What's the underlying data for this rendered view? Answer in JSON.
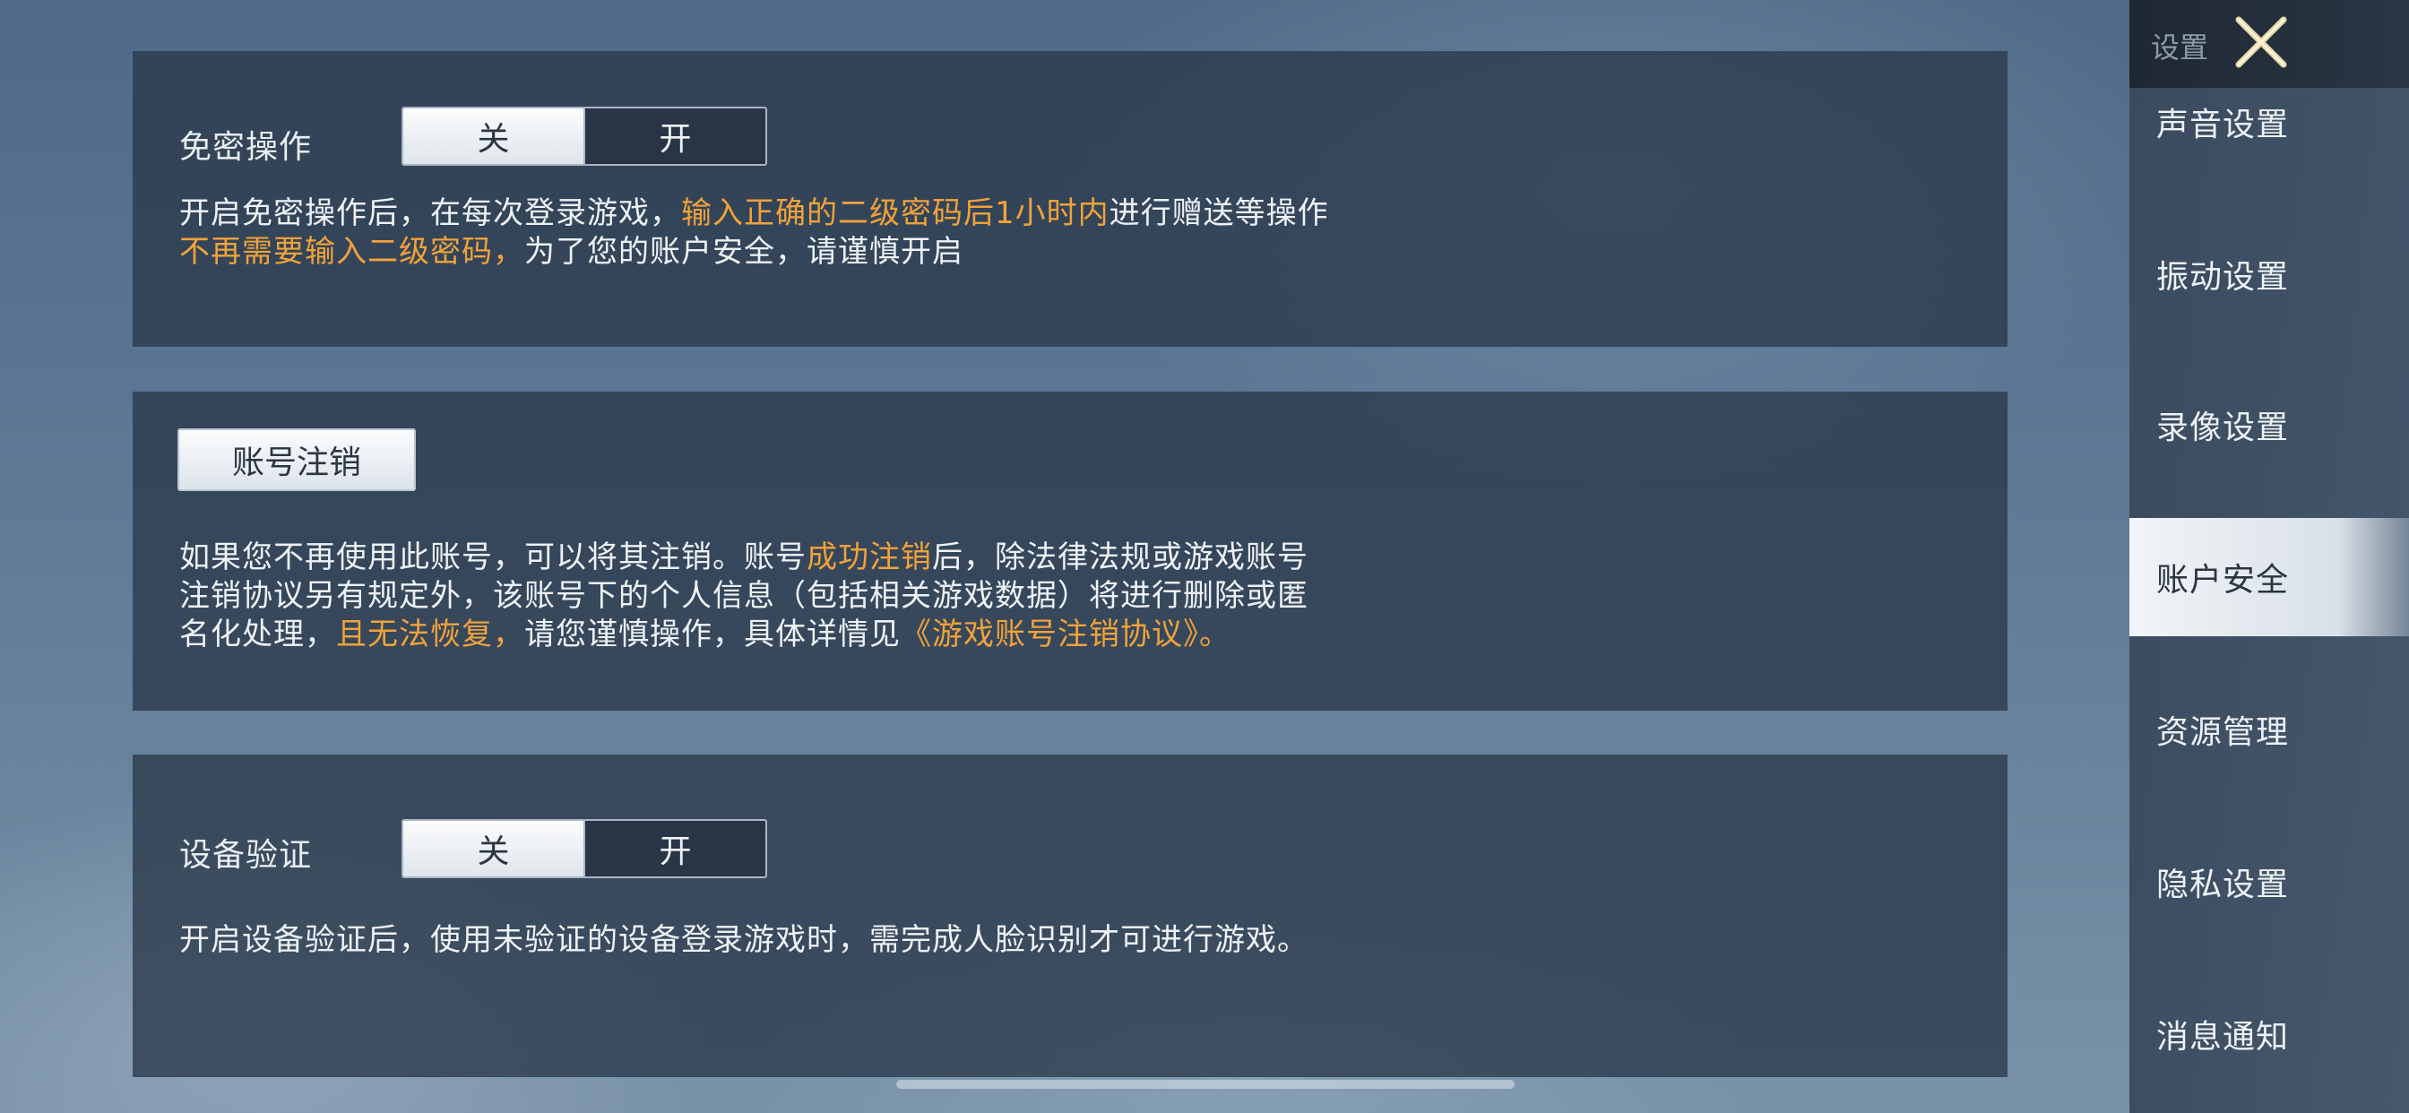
{
  "panels": {
    "password_free": {
      "label": "免密操作",
      "toggle": {
        "off_label": "关",
        "on_label": "开",
        "selected": "关"
      },
      "desc": {
        "line1_a": "开启免密操作后，在每次登录游戏，",
        "line1_hl": "输入正确的二级密码后1小时内",
        "line1_b": "进行赠送等操作",
        "line2_hl": "不再需要输入二级密码，",
        "line2_b": "为了您的账户安全，请谨慎开启"
      }
    },
    "account_cancel": {
      "button_label": "账号注销",
      "desc": {
        "line1_a": "如果您不再使用此账号，可以将其注销。账号",
        "line1_hl": "成功注销",
        "line1_b": "后，除法律法规或游戏账号",
        "line2": "注销协议另有规定外，该账号下的个人信息（包括相关游戏数据）将进行删除或匿",
        "line3_a": "名化处理，",
        "line3_hl": "且无法恢复，",
        "line3_b": "请您谨慎操作，具体详情见",
        "line3_link": "《游戏账号注销协议》。"
      }
    },
    "device_verify": {
      "label": "设备验证",
      "toggle": {
        "off_label": "关",
        "on_label": "开",
        "selected": "关"
      },
      "desc": "开启设备验证后，使用未验证的设备登录游戏时，需完成人脸识别才可进行游戏。"
    }
  },
  "sidebar": {
    "title": "设置",
    "items": [
      {
        "label": "声音设置"
      },
      {
        "label": "振动设置"
      },
      {
        "label": "录像设置"
      },
      {
        "label": "账户安全",
        "active": true
      },
      {
        "label": "资源管理"
      },
      {
        "label": "隐私设置"
      },
      {
        "label": "消息通知"
      }
    ]
  },
  "colors": {
    "highlight": "#f1a23a",
    "panel_bg": "#2a384a",
    "active_nav_bg": "#f5f8fb"
  }
}
